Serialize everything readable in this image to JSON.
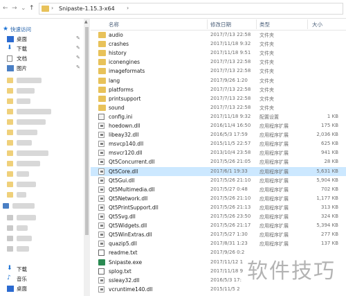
{
  "address": {
    "folder": "Snipaste-1.15.3-x64"
  },
  "sidebar": {
    "quick_access": "快速访问",
    "items": [
      {
        "label": "桌面",
        "icon": "desktop-icon"
      },
      {
        "label": "下载",
        "icon": "download-icon"
      },
      {
        "label": "文档",
        "icon": "documents-icon"
      },
      {
        "label": "图片",
        "icon": "pictures-icon"
      }
    ],
    "bottom_items": [
      {
        "label": "下载",
        "icon": "download-icon"
      },
      {
        "label": "音乐",
        "icon": "music-icon"
      },
      {
        "label": "桌面",
        "icon": "desktop-icon"
      }
    ]
  },
  "columns": {
    "name": "名称",
    "date": "修改日期",
    "type": "类型",
    "size": "大小"
  },
  "files": [
    {
      "name": "audio",
      "date": "2017/7/13 22:58",
      "type": "文件夹",
      "size": "",
      "kind": "folder"
    },
    {
      "name": "crashes",
      "date": "2017/11/18 9:32",
      "type": "文件夹",
      "size": "",
      "kind": "folder"
    },
    {
      "name": "history",
      "date": "2017/11/18 9:51",
      "type": "文件夹",
      "size": "",
      "kind": "folder"
    },
    {
      "name": "iconengines",
      "date": "2017/7/13 22:58",
      "type": "文件夹",
      "size": "",
      "kind": "folder"
    },
    {
      "name": "imageformats",
      "date": "2017/7/13 22:58",
      "type": "文件夹",
      "size": "",
      "kind": "folder"
    },
    {
      "name": "lang",
      "date": "2017/9/26 1:20",
      "type": "文件夹",
      "size": "",
      "kind": "folder"
    },
    {
      "name": "platforms",
      "date": "2017/7/13 22:58",
      "type": "文件夹",
      "size": "",
      "kind": "folder"
    },
    {
      "name": "printsupport",
      "date": "2017/7/13 22:58",
      "type": "文件夹",
      "size": "",
      "kind": "folder"
    },
    {
      "name": "sound",
      "date": "2017/7/13 22:58",
      "type": "文件夹",
      "size": "",
      "kind": "folder"
    },
    {
      "name": "config.ini",
      "date": "2017/11/18 9:32",
      "type": "配置设置",
      "size": "1 KB",
      "kind": "ini"
    },
    {
      "name": "hoedown.dll",
      "date": "2016/11/4 16:50",
      "type": "应用程序扩展",
      "size": "175 KB",
      "kind": "dll"
    },
    {
      "name": "libeay32.dll",
      "date": "2016/5/3 17:59",
      "type": "应用程序扩展",
      "size": "2,036 KB",
      "kind": "dll"
    },
    {
      "name": "msvcp140.dll",
      "date": "2015/11/5 22:57",
      "type": "应用程序扩展",
      "size": "625 KB",
      "kind": "dll"
    },
    {
      "name": "msvcr120.dll",
      "date": "2013/10/4 23:58",
      "type": "应用程序扩展",
      "size": "941 KB",
      "kind": "dll"
    },
    {
      "name": "Qt5Concurrent.dll",
      "date": "2017/5/26 21:05",
      "type": "应用程序扩展",
      "size": "28 KB",
      "kind": "dll"
    },
    {
      "name": "Qt5Core.dll",
      "date": "2017/6/1 19:33",
      "type": "应用程序扩展",
      "size": "5,631 KB",
      "kind": "dll",
      "selected": true
    },
    {
      "name": "Qt5Gui.dll",
      "date": "2017/5/26 21:10",
      "type": "应用程序扩展",
      "size": "5,904 KB",
      "kind": "dll"
    },
    {
      "name": "Qt5Multimedia.dll",
      "date": "2017/5/27 0:48",
      "type": "应用程序扩展",
      "size": "702 KB",
      "kind": "dll"
    },
    {
      "name": "Qt5Network.dll",
      "date": "2017/5/26 21:10",
      "type": "应用程序扩展",
      "size": "1,177 KB",
      "kind": "dll"
    },
    {
      "name": "Qt5PrintSupport.dll",
      "date": "2017/5/26 21:13",
      "type": "应用程序扩展",
      "size": "313 KB",
      "kind": "dll"
    },
    {
      "name": "Qt5Svg.dll",
      "date": "2017/5/26 23:50",
      "type": "应用程序扩展",
      "size": "324 KB",
      "kind": "dll"
    },
    {
      "name": "Qt5Widgets.dll",
      "date": "2017/5/26 21:17",
      "type": "应用程序扩展",
      "size": "5,394 KB",
      "kind": "dll"
    },
    {
      "name": "Qt5WinExtras.dll",
      "date": "2017/5/27 1:30",
      "type": "应用程序扩展",
      "size": "277 KB",
      "kind": "dll"
    },
    {
      "name": "quazip5.dll",
      "date": "2017/8/31 1:23",
      "type": "应用程序扩展",
      "size": "137 KB",
      "kind": "dll"
    },
    {
      "name": "readme.txt",
      "date": "2017/9/26 0:2",
      "type": "",
      "size": "",
      "kind": "txt"
    },
    {
      "name": "Snipaste.exe",
      "date": "2017/11/12 1",
      "type": "",
      "size": "",
      "kind": "exe"
    },
    {
      "name": "splog.txt",
      "date": "2017/11/18 9",
      "type": "",
      "size": "",
      "kind": "txt"
    },
    {
      "name": "ssleay32.dll",
      "date": "2016/5/3 17:",
      "type": "",
      "size": "",
      "kind": "dll"
    },
    {
      "name": "vcruntime140.dll",
      "date": "2015/11/5 2",
      "type": "",
      "size": "",
      "kind": "dll"
    }
  ],
  "watermark": "软件技巧"
}
